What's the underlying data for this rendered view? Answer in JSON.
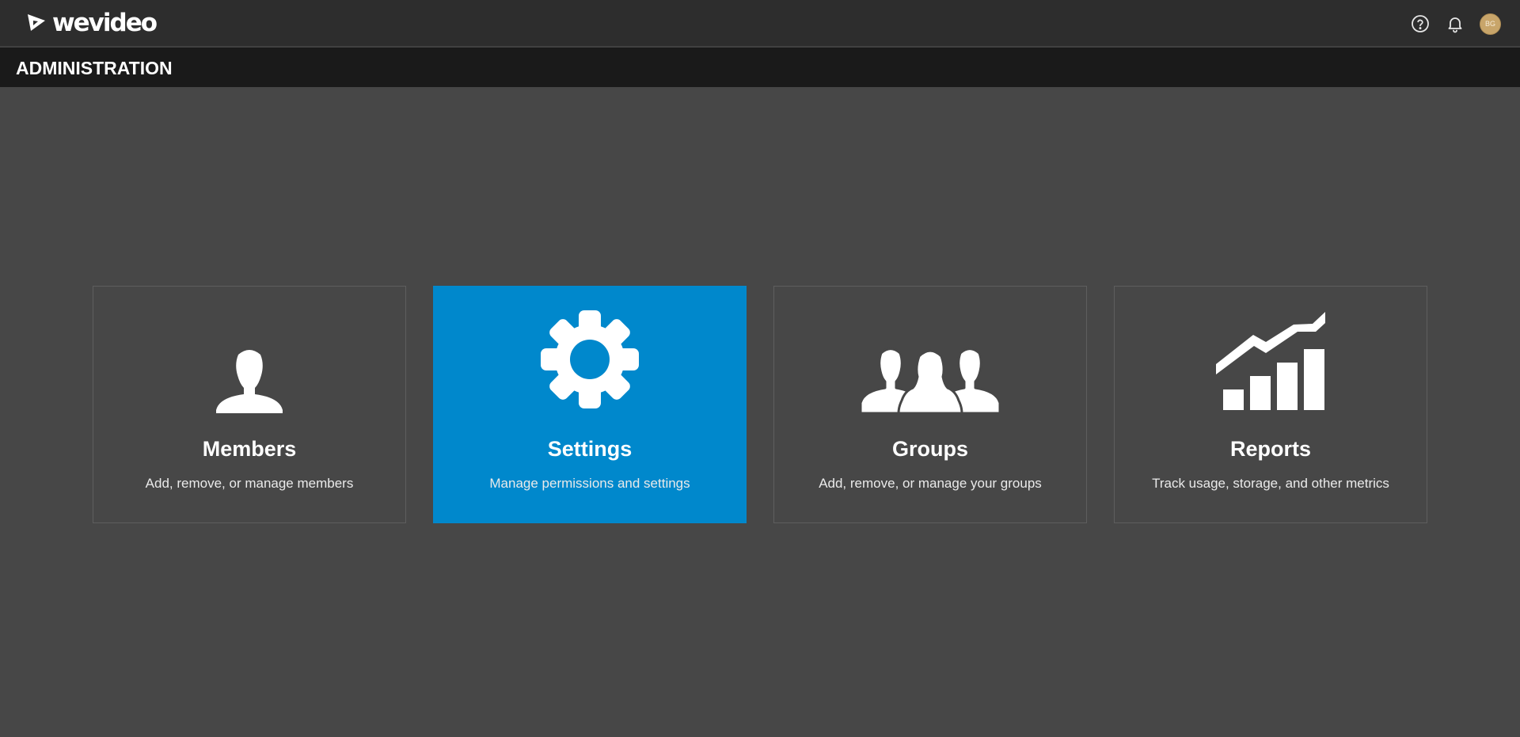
{
  "app": {
    "logo_text": "wevideo",
    "logo_icon": "wevideo-logo-icon"
  },
  "topbar": {
    "help_icon": "help-circle-icon",
    "notifications_icon": "bell-icon",
    "avatar_initials": "BG",
    "avatar_color": "#c8a56a"
  },
  "page": {
    "title": "ADMINISTRATION"
  },
  "colors": {
    "accent": "#0088cc",
    "background": "#474747",
    "topbar": "#2d2d2d",
    "admin_bar": "#1a1a1a"
  },
  "cards": [
    {
      "title": "Members",
      "description": "Add, remove, or manage members",
      "icon": "member-icon",
      "active": false
    },
    {
      "title": "Settings",
      "description": "Manage permissions and settings",
      "icon": "gear-icon",
      "active": true
    },
    {
      "title": "Groups",
      "description": "Add, remove, or manage your groups",
      "icon": "groups-icon",
      "active": false
    },
    {
      "title": "Reports",
      "description": "Track usage, storage, and other metrics",
      "icon": "reports-chart-icon",
      "active": false
    }
  ]
}
